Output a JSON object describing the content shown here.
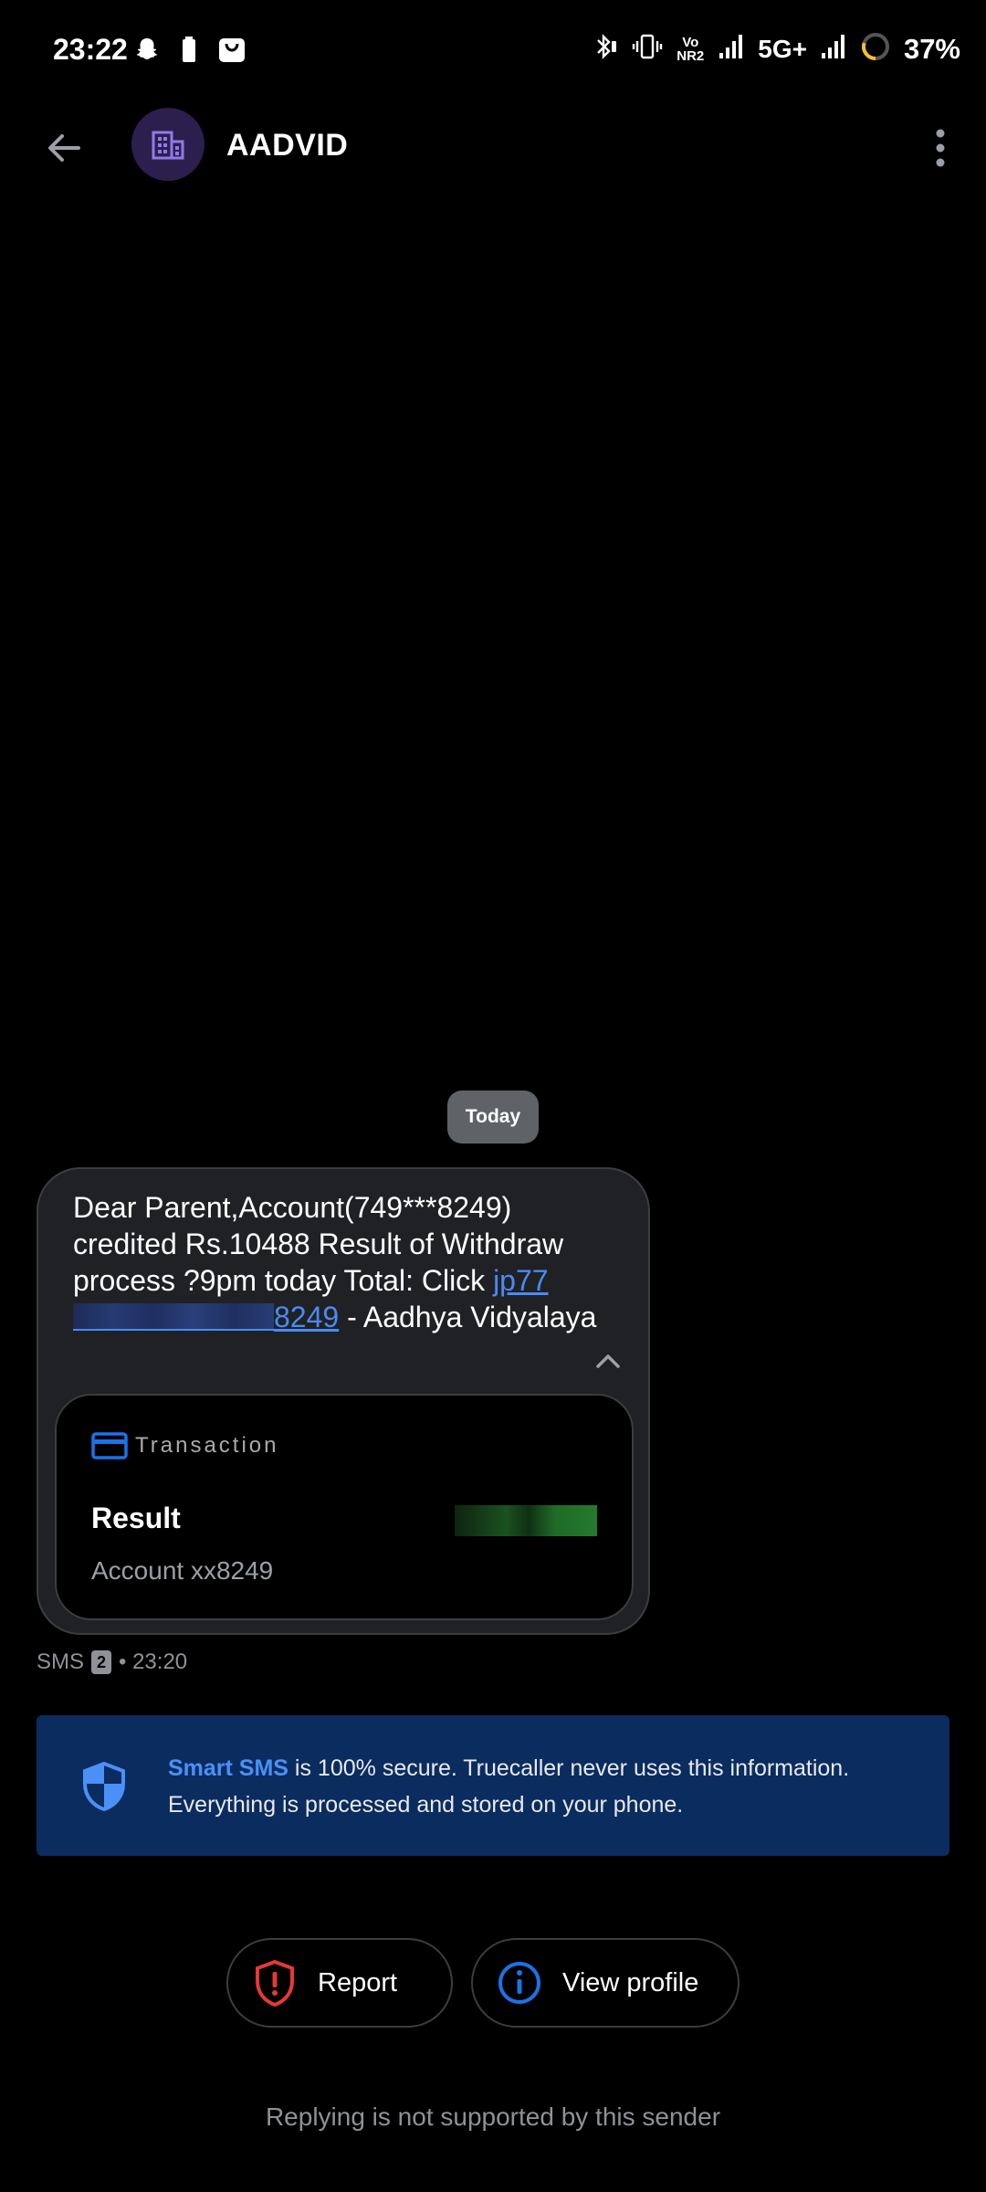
{
  "status_bar": {
    "time": "23:22",
    "network_labels": {
      "volte": "Vo NR2",
      "five_g": "5G+"
    },
    "battery_percent": "37%",
    "icons": [
      "snapchat-icon",
      "battery-saver-icon",
      "shopping-bag-icon",
      "bluetooth-off-icon",
      "vibrate-icon",
      "volte-icon",
      "signal-icon",
      "signal-icon",
      "battery-ring-icon"
    ]
  },
  "header": {
    "sender_name": "AADVID",
    "avatar_icon": "building-icon",
    "back_icon": "arrow-left-icon",
    "more_icon": "more-vert-icon"
  },
  "thread": {
    "date_chip": "Today",
    "message": {
      "text_before_link": "Dear Parent,Account(749***8249) credited Rs.10488 Result of Withdraw process ?9pm today Total: Click ",
      "link_prefix": "jp77",
      "link_suffix": "8249",
      "text_after_link": " - Aadhya Vidyalaya",
      "collapse_icon": "chevron-up-icon",
      "accent_link_color": "#4a8af4"
    },
    "transaction_card": {
      "label": "Transaction",
      "icon": "credit-card-icon",
      "result_label": "Result",
      "account": "Account xx8249"
    },
    "meta": {
      "channel": "SMS",
      "sim": "2",
      "time": "• 23:20"
    }
  },
  "smart_sms_banner": {
    "icon": "shield-icon",
    "strong": "Smart SMS",
    "text": " is 100% secure. Truecaller never uses this information. Everything is processed and stored on your phone.",
    "background_color": "#0b2c5f"
  },
  "actions": {
    "report": {
      "label": "Report",
      "icon": "shield-alert-icon",
      "color": "#e53935"
    },
    "view_profile": {
      "label": "View profile",
      "icon": "info-icon",
      "color": "#1a73e8"
    }
  },
  "footer": {
    "note": "Replying is not supported by this sender"
  }
}
